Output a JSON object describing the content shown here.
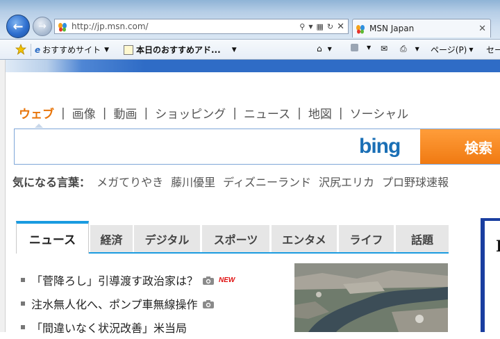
{
  "browser": {
    "address_url": "http://jp.msn.com/",
    "tab_title": "MSN Japan",
    "favorites": [
      {
        "label": "おすすめサイト",
        "has_dropdown": true
      },
      {
        "label": "本日のおすすめアド...",
        "has_dropdown": true
      }
    ],
    "command_bar": {
      "page_menu": "ページ(P)",
      "safety_menu": "セー"
    }
  },
  "site": {
    "search_categories": [
      "ウェブ",
      "画像",
      "動画",
      "ショッピング",
      "ニュース",
      "地図",
      "ソーシャル"
    ],
    "active_category": "ウェブ",
    "bing_logo": "bing",
    "search_button": "検索",
    "trending_label": "気になる言葉：",
    "trending_keywords": [
      "メガてりやき",
      "藤川優里",
      "ディズニーランド",
      "沢尻エリカ",
      "プロ野球速報"
    ],
    "news_tabs": [
      "ニュース",
      "経済",
      "デジタル",
      "スポーツ",
      "エンタメ",
      "ライフ",
      "話題"
    ],
    "active_news_tab": "ニュース",
    "headlines": [
      {
        "text": "「菅降ろし」引導渡す政治家は？",
        "camera": true,
        "new": true
      },
      {
        "text": "注水無人化へ、ポンプ車無線操作",
        "camera": true,
        "new": false
      },
      {
        "text": "「間違いなく状況改善」米当局",
        "camera": false,
        "new": false
      }
    ],
    "new_badge": "NEW",
    "right_panel_char": "I"
  },
  "colors": {
    "accent_orange": "#e8750a",
    "tab_blue": "#1a9be0",
    "bing_blue": "#1a6fb5",
    "search_button": "#f07a12"
  }
}
